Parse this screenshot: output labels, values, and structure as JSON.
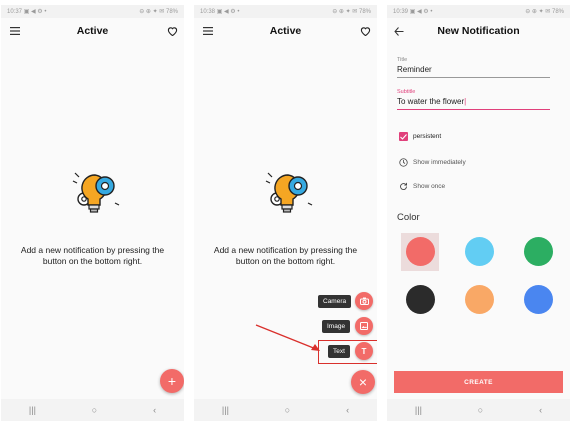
{
  "screens": [
    {
      "status": {
        "time": "10:37",
        "icons": "▣ ◀ ⚙ •",
        "right": "⊖ ⊕ ✦ ✉ 78%"
      },
      "title": "Active",
      "empty_text": "Add a new notification by pressing the button on the bottom right.",
      "fab_icon": "+",
      "nav": [
        "|||",
        "○",
        "‹"
      ]
    },
    {
      "status": {
        "time": "10:38",
        "icons": "▣ ◀ ⚙ •",
        "right": "⊖ ⊕ ✦ ✉ 78%"
      },
      "title": "Active",
      "empty_text": "Add a new notification by pressing the button on the bottom right.",
      "speed_dial": [
        {
          "label": "Camera",
          "icon": "camera-icon"
        },
        {
          "label": "Image",
          "icon": "image-icon"
        },
        {
          "label": "Text",
          "icon": "text-icon"
        }
      ],
      "fab_icon": "×",
      "nav": [
        "|||",
        "○",
        "‹"
      ]
    },
    {
      "status": {
        "time": "10:39",
        "icons": "▣ ◀ ⚙ •",
        "right": "⊖ ⊕ ✦ ✉ 78%"
      },
      "title": "New Notification",
      "fields": {
        "title_label": "Title",
        "title_value": "Reminder",
        "subtitle_label": "Subtitle",
        "subtitle_value": "To water the flower"
      },
      "options": {
        "persistent": "persistent",
        "show_immediately": "Show immediately",
        "show_once": "Show once"
      },
      "color_heading": "Color",
      "colors": [
        "#f26b68",
        "#62cdf3",
        "#2cae62",
        "#2b2b2b",
        "#f9a866",
        "#4a86f0"
      ],
      "selected_color": 0,
      "create_label": "CREATE",
      "nav": [
        "|||",
        "○",
        "‹"
      ]
    }
  ]
}
